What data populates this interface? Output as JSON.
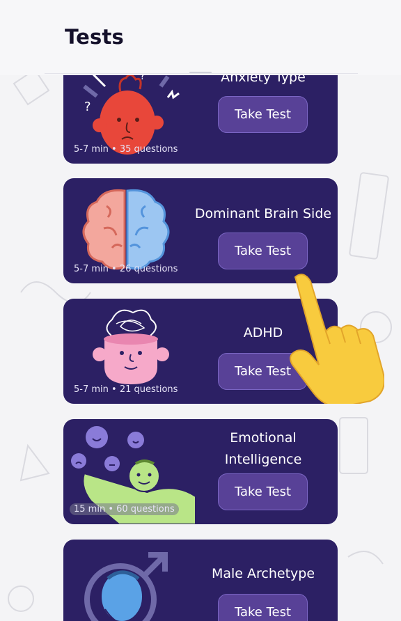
{
  "header": {
    "title": "Tests"
  },
  "tests": [
    {
      "name": "Anxiety Type",
      "meta": "5-7 min • 35 questions",
      "button": "Take Test",
      "icon": "anxious-head-icon"
    },
    {
      "name": "Dominant Brain Side",
      "meta": "5-7 min • 26 questions",
      "button": "Take Test",
      "icon": "brain-halves-icon"
    },
    {
      "name": "ADHD",
      "meta": "5-7 min • 21 questions",
      "button": "Take Test",
      "icon": "tangled-mind-head-icon"
    },
    {
      "name": "Emotional Intelligence",
      "meta": "15 min • 60 questions",
      "button": "Take Test",
      "icon": "emotions-person-icon"
    },
    {
      "name": "Male Archetype",
      "meta": "",
      "button": "Take Test",
      "icon": "male-symbol-person-icon"
    }
  ],
  "overlay": {
    "icon": "pointing-hand-icon"
  },
  "colors": {
    "card": "#2c2064",
    "button": "#584197",
    "background": "#f4f4f6"
  }
}
